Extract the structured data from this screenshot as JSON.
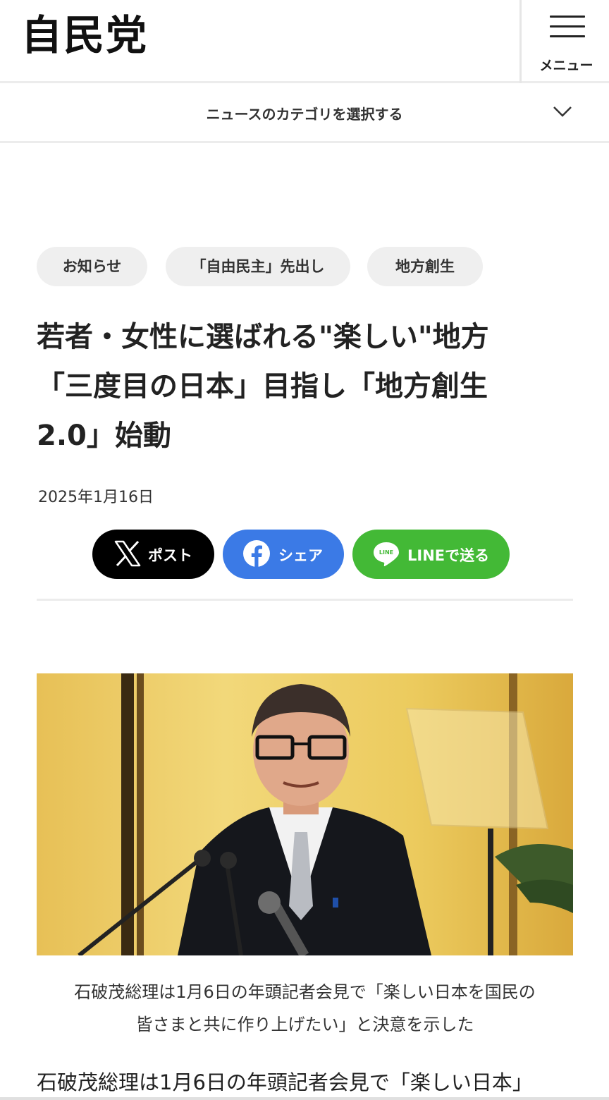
{
  "header": {
    "logo": "自民党",
    "menu_label": "メニュー"
  },
  "category_selector": {
    "label": "ニュースのカテゴリを選択する"
  },
  "tags": [
    "お知らせ",
    "「自由民主」先出し",
    "地方創生"
  ],
  "article": {
    "title_lines": [
      "若者・女性に選ばれる\"楽しい\"地方",
      "「三度目の日本」目指し「地方創生",
      "2.0」始動"
    ],
    "date": "2025年1月16日",
    "caption_lines": [
      "石破茂総理は1月6日の年頭記者会見で「楽しい日本を国民の",
      "皆さまと共に作り上げたい」と決意を示した"
    ],
    "body_first_line": "石破茂総理は1月6日の年頭記者会見で「楽しい日本」"
  },
  "share_buttons": {
    "x": {
      "label": "ポスト",
      "color": "#000000"
    },
    "facebook": {
      "label": "シェア",
      "color": "#3b7ae6"
    },
    "line": {
      "label": "LINEで送る",
      "color": "#43b936",
      "icon_text": "LINE"
    }
  }
}
